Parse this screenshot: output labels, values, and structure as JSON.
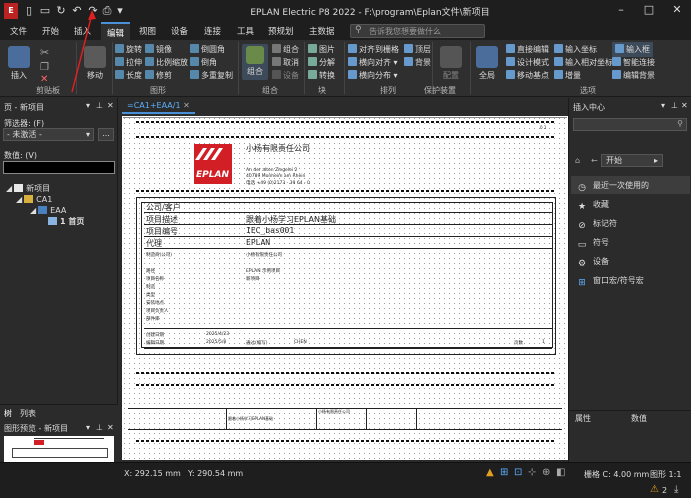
{
  "window": {
    "title": "EPLAN Electric P8 2022 - F:\\program\\Eplan文件\\新项目"
  },
  "menu": {
    "items": [
      "文件",
      "开始",
      "插入",
      "编辑",
      "视图",
      "设备",
      "连接",
      "工具",
      "预规划",
      "主数据"
    ],
    "active_index": 3,
    "search_placeholder": "告诉我您想要做什么"
  },
  "ribbon": {
    "insert_label": "插入",
    "move_label": "移动",
    "clipboard_group": "剪贴板",
    "graphic_group": "图形",
    "cells": [
      "旋转",
      "镜像",
      "倒圆角",
      "拉伸",
      "比例缩放",
      "倒角",
      "长度",
      "修剪",
      "多重复制"
    ],
    "combine_label": "组合",
    "combine_items": [
      "组合",
      "取消",
      "设备"
    ],
    "group_label": "组合",
    "block_items": [
      "图片",
      "分解",
      "转换"
    ],
    "block_group": "块",
    "arrange_items": [
      "对齐到栅格",
      "顶层",
      "横向对齐",
      "背景",
      "横向分布"
    ],
    "arrange_group": "排列",
    "config_label": "配置",
    "layout_group": "保护装置",
    "fullscreen_label": "全局",
    "options_items": [
      "直接编辑",
      "输入坐标",
      "输入框",
      "设计模式",
      "输入相对坐标",
      "智能连接",
      "移动基点",
      "增量",
      "编辑背景"
    ],
    "options_group": "选项"
  },
  "left_panel": {
    "title": "页 - 新项目",
    "filter_label": "筛选器: (F)",
    "filter_value": "- 未激活 -",
    "filter_btn": "...",
    "value_label": "数值: (V)",
    "tree": [
      {
        "label": "新项目",
        "level": 0
      },
      {
        "label": "CA1",
        "level": 1
      },
      {
        "label": "EAA",
        "level": 2
      },
      {
        "label": "1 首页",
        "level": 3
      }
    ],
    "tabs": [
      "树",
      "列表"
    ],
    "preview_title": "图形预览 - 新项目"
  },
  "document": {
    "tab": "=CA1+EAA/1",
    "sheet": {
      "company": "小杨有限责任公司",
      "logo": "EPLAN",
      "addr1": "An der alten Ziegelei 2",
      "addr2": "40789    Monheim am Rhein",
      "phone": "电话   +49 (0)2173 - 39 64 - 0",
      "fields": [
        {
          "k": "公司/客户",
          "v": "小杨有限责任公司"
        },
        {
          "k": "项目描述",
          "v": "跟着小杨学习EPLAN基础"
        },
        {
          "k": "项目编号",
          "v": "IEC_bas001"
        },
        {
          "k": "代理",
          "v": "EPLAN"
        }
      ],
      "small_rows": [
        {
          "k": "制造商(公司)",
          "v": "小杨有限责任公司"
        },
        {
          "k": "路径",
          "v": "EPLAN 示例项目"
        },
        {
          "k": "项目名称",
          "v": "新项目"
        },
        {
          "k": "制造",
          "v": ""
        },
        {
          "k": "类型",
          "v": ""
        },
        {
          "k": "安装地点",
          "v": ""
        },
        {
          "k": "项目负责人",
          "v": ""
        },
        {
          "k": "部件库",
          "v": ""
        }
      ],
      "created_label": "创建日期",
      "created_value": "2025/4/23",
      "edited_label": "编辑日期",
      "edited_value": "2025/5/8",
      "by_label": "通过(缩写)",
      "by_value": "CHEN",
      "pages_label": "页数",
      "pages_value": "1"
    }
  },
  "right_panel": {
    "title": "插入中心",
    "search_placeholder": "",
    "nav_label": "开始",
    "items": [
      {
        "label": "最近一次使用的",
        "icon": "clock-icon"
      },
      {
        "label": "收藏",
        "icon": "star-icon"
      },
      {
        "label": "标记符",
        "icon": "tag-icon"
      },
      {
        "label": "符号",
        "icon": "symbol-icon"
      },
      {
        "label": "设备",
        "icon": "device-icon"
      },
      {
        "label": "窗口宏/符号宏",
        "icon": "macro-icon"
      }
    ],
    "props_tabs": [
      "属性",
      "数值"
    ]
  },
  "status": {
    "x": "X: 292.15 mm",
    "y": "Y: 290.54 mm",
    "grid": "栅格 C: 4.00 mm",
    "scale": "图形 1:1"
  },
  "bottom": {
    "count": "2"
  },
  "colors": {
    "accent": "#4a90d9",
    "eplan_red": "#d21f26"
  }
}
